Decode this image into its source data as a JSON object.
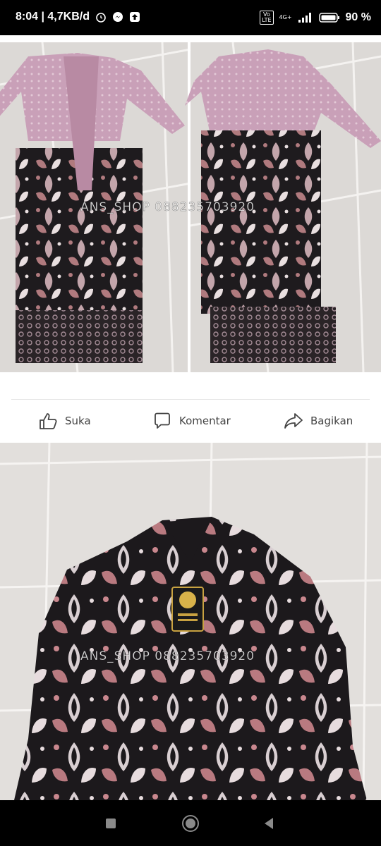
{
  "status_bar": {
    "time": "8:04 | 4,7KB/d",
    "volte_label": "Vo\nLTE",
    "network_label": "4G+",
    "battery_percent": "90 %",
    "icons": [
      "alarm-icon",
      "messenger-icon",
      "upload-icon",
      "signal-icon",
      "battery-icon"
    ]
  },
  "post": {
    "watermark_top": "ANS_SHOP  088235703920",
    "watermark_bottom": "ANS_SHOP  088235703920"
  },
  "actions": {
    "like_label": "Suka",
    "comment_label": "Komentar",
    "share_label": "Bagikan"
  },
  "navigation": {
    "icons": [
      "recent-apps-icon",
      "home-icon",
      "back-icon"
    ]
  },
  "colors": {
    "kebaya_pink": "#c9a0b8",
    "batik_dark": "#1e1b1e",
    "batik_rose": "#b07a7e",
    "floor_tile": "#dcd9d6"
  }
}
